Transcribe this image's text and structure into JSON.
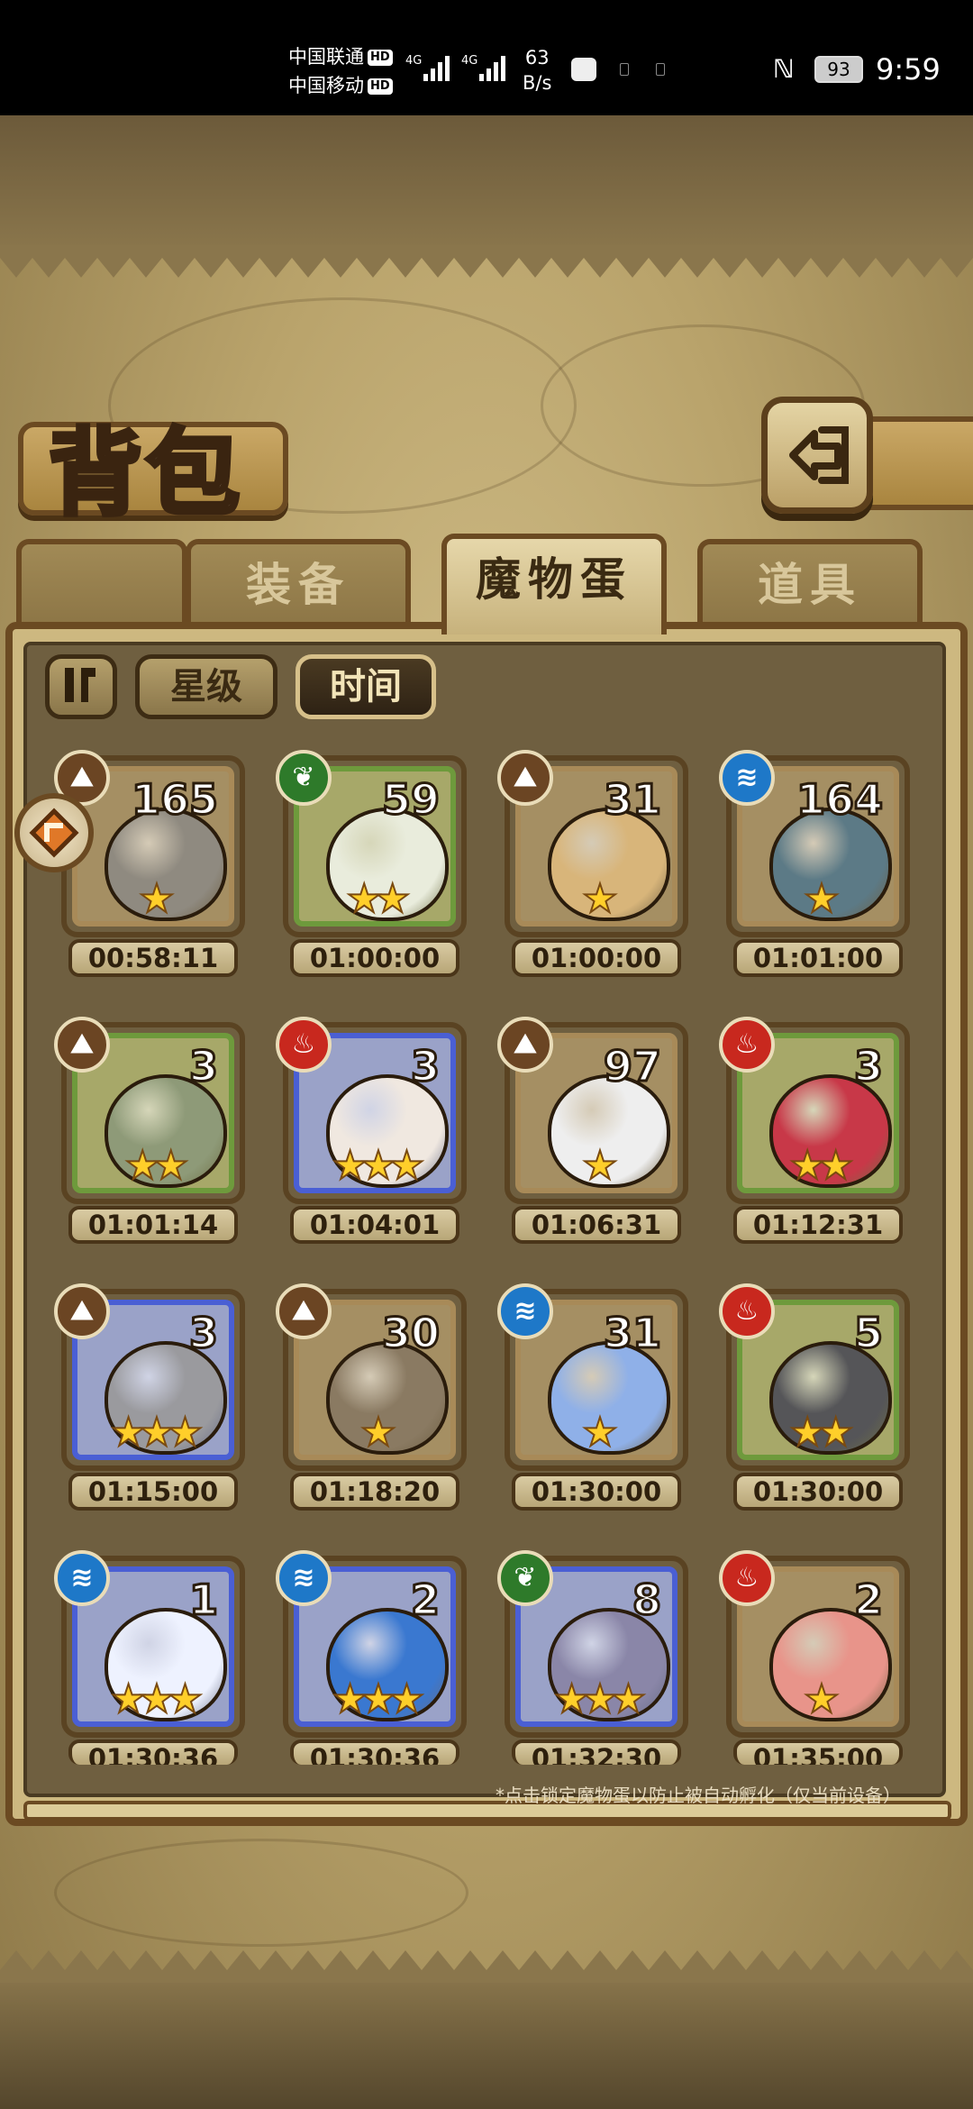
{
  "status_bar": {
    "carrier1": "中国联通",
    "carrier2": "中国移动",
    "hd": "HD",
    "net1": "4G",
    "net2": "4G",
    "speed_value": "63",
    "speed_unit": "B/s",
    "battery": "93",
    "time": "9:59"
  },
  "header": {
    "title": "背包"
  },
  "tabs": [
    {
      "label": "装备",
      "active": false
    },
    {
      "label": "魔物蛋",
      "active": true
    },
    {
      "label": "道具",
      "active": false
    }
  ],
  "sort": {
    "star_label": "星级",
    "time_label": "时间",
    "selected": "时间"
  },
  "eggs": [
    {
      "element": "earth",
      "rarity": "brown",
      "count": "165",
      "stars": 1,
      "time": "00:58:11",
      "color": "#8f8a80"
    },
    {
      "element": "plant",
      "rarity": "green",
      "count": "59",
      "stars": 2,
      "time": "01:00:00",
      "color": "#e9ecdc"
    },
    {
      "element": "earth",
      "rarity": "brown",
      "count": "31",
      "stars": 1,
      "time": "01:00:00",
      "color": "#d8b57a"
    },
    {
      "element": "water",
      "rarity": "brown",
      "count": "164",
      "stars": 1,
      "time": "01:01:00",
      "color": "#5c7a86"
    },
    {
      "element": "earth",
      "rarity": "green",
      "count": "3",
      "stars": 2,
      "time": "01:01:14",
      "color": "#8e9a78"
    },
    {
      "element": "fire",
      "rarity": "blue",
      "count": "3",
      "stars": 3,
      "time": "01:04:01",
      "color": "#f0e8e0"
    },
    {
      "element": "earth",
      "rarity": "brown",
      "count": "97",
      "stars": 1,
      "time": "01:06:31",
      "color": "#eeeeee"
    },
    {
      "element": "fire",
      "rarity": "green",
      "count": "3",
      "stars": 2,
      "time": "01:12:31",
      "color": "#c83848"
    },
    {
      "element": "earth",
      "rarity": "blue",
      "count": "3",
      "stars": 3,
      "time": "01:15:00",
      "color": "#9a9a9e"
    },
    {
      "element": "earth",
      "rarity": "brown",
      "count": "30",
      "stars": 1,
      "time": "01:18:20",
      "color": "#8a7a62"
    },
    {
      "element": "water",
      "rarity": "brown",
      "count": "31",
      "stars": 1,
      "time": "01:30:00",
      "color": "#8fb0e8"
    },
    {
      "element": "fire",
      "rarity": "green",
      "count": "5",
      "stars": 2,
      "time": "01:30:00",
      "color": "#555558"
    },
    {
      "element": "water",
      "rarity": "blue",
      "count": "1",
      "stars": 3,
      "time": "01:30:36",
      "color": "#eef2ff"
    },
    {
      "element": "water",
      "rarity": "blue",
      "count": "2",
      "stars": 3,
      "time": "01:30:36",
      "color": "#3a78d0"
    },
    {
      "element": "plant",
      "rarity": "blue",
      "count": "8",
      "stars": 3,
      "time": "01:32:30",
      "color": "#8a86a8"
    },
    {
      "element": "fire",
      "rarity": "brown",
      "count": "2",
      "stars": 1,
      "time": "01:35:00",
      "color": "#e8948a"
    }
  ],
  "footnote": "*点击锁定魔物蛋以防止被自动孵化（仅当前设备）"
}
